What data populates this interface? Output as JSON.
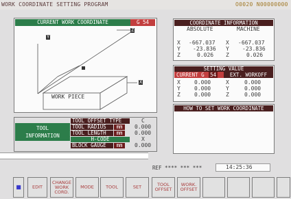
{
  "program_title": "WORK COORDINATE SETTING PROGRAM",
  "onumber": "O0020 N00000000",
  "current_work": {
    "header": "CURRENT WORK COORDINATE",
    "value": "G 54",
    "diagram_label": "WORK PIECE",
    "axis_y": "Y",
    "axis_z": "Z",
    "axis_x": "X"
  },
  "coord_info": {
    "header": "COORDINATE INFORMATION",
    "col_abs": "ABSOLUTE",
    "col_mach": "MACHINE",
    "rows": [
      {
        "axis": "X",
        "abs": "-667.037",
        "mach_axis": "X",
        "mach": "-667.037"
      },
      {
        "axis": "Y",
        "abs": "-23.836",
        "mach_axis": "Y",
        "mach": "-23.836"
      },
      {
        "axis": "Z",
        "abs": "0.026",
        "mach_axis": "Z",
        "mach": "0.026"
      }
    ]
  },
  "setting_value": {
    "header": "SETTING VALUE",
    "col_current": "CURRENT G",
    "col_g": "54",
    "col_ext": "EXT. WORKOFF",
    "rows": [
      {
        "axis": "X",
        "cur": "0.000",
        "ext_axis": "X",
        "ext": "0.000"
      },
      {
        "axis": "Y",
        "cur": "0.000",
        "ext_axis": "Y",
        "ext": "0.000"
      },
      {
        "axis": "Z",
        "cur": "0.000",
        "ext_axis": "Z",
        "ext": "0.000"
      }
    ]
  },
  "howto": {
    "header": "HOW TO SET WORK COORDINATE"
  },
  "tool_info": {
    "label_line1": "TOOL",
    "label_line2": "INFORMATION",
    "rows": [
      {
        "name": "TOOL OFFSET TYPE",
        "unit": "",
        "value": "C"
      },
      {
        "name": "TOOL RADIUS",
        "unit": "mm",
        "value": "0.000"
      },
      {
        "name": "TOOL LENGTH",
        "unit": "mm",
        "value": "0.000"
      },
      {
        "name": "H-CODE",
        "unit": "",
        "value": "X"
      },
      {
        "name": "BLOCK GAUGE",
        "unit": "mm",
        "value": "0.000"
      }
    ]
  },
  "status": {
    "ref": "REF **** *** ***",
    "time": "14:25:36"
  },
  "softkeys": [
    {
      "label": "■",
      "id": "softkey-return"
    },
    {
      "label": "EDIT",
      "id": "softkey-edit"
    },
    {
      "label": "CHANGE\nWORK\nCORD.",
      "id": "softkey-change-work-cord"
    },
    {
      "label": "MODE",
      "id": "softkey-mode"
    },
    {
      "label": "TOOL",
      "id": "softkey-tool"
    },
    {
      "label": "SET",
      "id": "softkey-set"
    },
    {
      "label": "TOOL\nOFFSET",
      "id": "softkey-tool-offset"
    },
    {
      "label": "WORK.\nOFFSET",
      "id": "softkey-work-offset"
    },
    {
      "label": "",
      "id": "softkey-blank-1"
    },
    {
      "label": "",
      "id": "softkey-blank-2"
    },
    {
      "label": "",
      "id": "softkey-blank-3"
    },
    {
      "label": "",
      "id": "softkey-blank-4"
    }
  ],
  "colors": {
    "header_green": "#2c7d4a",
    "header_maroon": "#4a1f1f",
    "accent_red": "#c23e3e",
    "panel_bg": "#fbfbfb",
    "text": "#3b3b3b"
  }
}
